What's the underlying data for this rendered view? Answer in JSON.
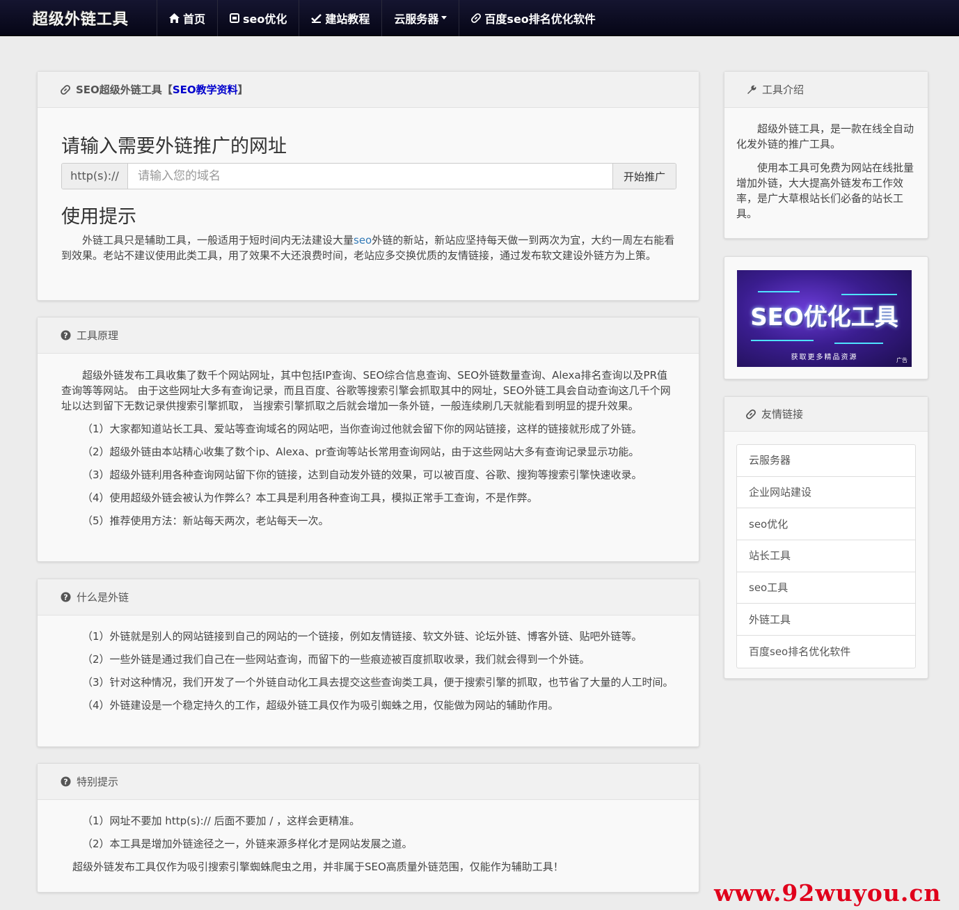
{
  "nav": {
    "brand": "超级外链工具",
    "items": [
      {
        "icon": "home-icon",
        "label": "首页"
      },
      {
        "icon": "seo-icon",
        "label": "seo优化"
      },
      {
        "icon": "check-icon",
        "label": "建站教程"
      },
      {
        "icon": "",
        "label": "云服务器"
      },
      {
        "icon": "link-icon",
        "label": "百度seo排名优化软件"
      }
    ]
  },
  "main": {
    "header_prefix": "SEO超级外链工具【",
    "header_link": "SEO教学资料",
    "header_suffix": "】",
    "title": "请输入需要外链推广的网址",
    "prefix": "http(s)://",
    "placeholder": "请输入您的域名",
    "button": "开始推广",
    "tips_title": "使用提示",
    "tips_a": "外链工具只是辅助工具，一般适用于短时间内无法建设大量",
    "tips_link": "seo",
    "tips_b": "外链的新站，新站应坚持每天做一到两次为宜，大约一周左右能看到效果。老站不建议使用此类工具，用了效果不大还浪费时间，老站应多交换优质的友情链接，通过发布软文建设外链方为上策。"
  },
  "principle": {
    "title": "工具原理",
    "intro": "超级外链发布工具收集了数千个网站网址，其中包括IP查询、SEO综合信息查询、SEO外链数量查询、Alexa排名查询以及PR值查询等等网站。 由于这些网址大多有查询记录，而且百度、谷歌等搜索引擎会抓取其中的网址，SEO外链工具会自动查询这几千个网址以达到留下无数记录供搜索引擎抓取， 当搜索引擎抓取之后就会增加一条外链，一般连续刷几天就能看到明显的提升效果。",
    "items": [
      "（1）大家都知道站长工具、爱站等查询域名的网站吧，当你查询过他就会留下你的网站链接，这样的链接就形成了外链。",
      "（2）超级外链由本站精心收集了数个ip、Alexa、pr查询等站长常用查询网站，由于这些网站大多有查询记录显示功能。",
      "（3）超级外链利用各种查询网站留下你的链接，达到自动发外链的效果，可以被百度、谷歌、搜狗等搜索引擎快速收录。",
      "（4）使用超级外链会被认为作弊么？本工具是利用各种查询工具，模拟正常手工查询，不是作弊。",
      "（5）推荐使用方法：新站每天两次，老站每天一次。"
    ]
  },
  "what": {
    "title": "什么是外链",
    "items": [
      "（1）外链就是别人的网站链接到自己的网站的一个链接，例如友情链接、软文外链、论坛外链、博客外链、贴吧外链等。",
      "（2）一些外链是通过我们自己在一些网站查询，而留下的一些痕迹被百度抓取收录，我们就会得到一个外链。",
      "（3）针对这种情况，我们开发了一个外链自动化工具去提交这些查询类工具，便于搜索引擎的抓取，也节省了大量的人工时间。",
      "（4）外链建设是一个稳定持久的工作，超级外链工具仅作为吸引蜘蛛之用，仅能做为网站的辅助作用。"
    ]
  },
  "special": {
    "title": "特别提示",
    "items": [
      "（1）网址不要加 http(s):// 后面不要加 / ，这样会更精准。",
      "（2）本工具是增加外链途径之一，外链来源多样化才是网站发展之道。"
    ],
    "footer": "超级外链发布工具仅作为吸引搜索引擎蜘蛛爬虫之用，并非属于SEO高质量外链范围，仅能作为辅助工具！"
  },
  "side": {
    "intro_title": "工具介绍",
    "intro_p1": "超级外链工具，是一款在线全自动化发外链的推广工具。",
    "intro_p2": "使用本工具可免费为网站在线批量增加外链，大大提高外链发布工作效率，是广大草根站长们必备的站长工具。",
    "ad_title": "SEO优化工具",
    "ad_sub": "获取更多精品资源",
    "ad_tag": "广告",
    "links_title": "友情链接",
    "links": [
      "云服务器",
      "企业网站建设",
      "seo优化",
      "站长工具",
      "seo工具",
      "外链工具",
      "百度seo排名优化软件"
    ]
  },
  "watermark": "www.92wuyou.cn",
  "colors": {
    "accent": "#0000cc",
    "nav_bg": "#0b0b22",
    "watermark": "#e0001b"
  }
}
